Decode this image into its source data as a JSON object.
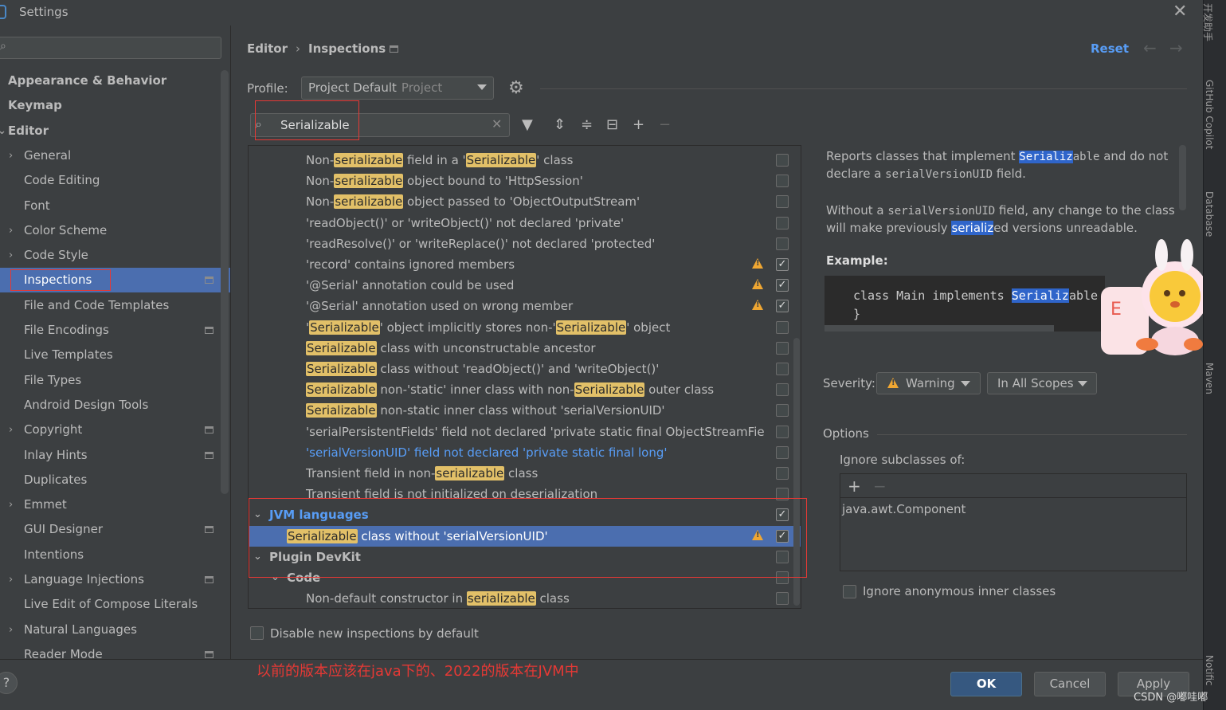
{
  "window": {
    "title": "Settings"
  },
  "sidebar": {
    "items": [
      {
        "label": "Appearance & Behavior",
        "type": "top"
      },
      {
        "label": "Keymap",
        "type": "top"
      },
      {
        "label": "Editor",
        "type": "top-expanded"
      },
      {
        "label": "General",
        "type": "sub-expandable"
      },
      {
        "label": "Code Editing",
        "type": "sub"
      },
      {
        "label": "Font",
        "type": "sub"
      },
      {
        "label": "Color Scheme",
        "type": "sub-expandable"
      },
      {
        "label": "Code Style",
        "type": "sub-expandable"
      },
      {
        "label": "Inspections",
        "type": "sub-selected"
      },
      {
        "label": "File and Code Templates",
        "type": "sub"
      },
      {
        "label": "File Encodings",
        "type": "sub"
      },
      {
        "label": "Live Templates",
        "type": "sub"
      },
      {
        "label": "File Types",
        "type": "sub"
      },
      {
        "label": "Android Design Tools",
        "type": "sub"
      },
      {
        "label": "Copyright",
        "type": "sub-expandable"
      },
      {
        "label": "Inlay Hints",
        "type": "sub"
      },
      {
        "label": "Duplicates",
        "type": "sub"
      },
      {
        "label": "Emmet",
        "type": "sub-expandable"
      },
      {
        "label": "GUI Designer",
        "type": "sub"
      },
      {
        "label": "Intentions",
        "type": "sub"
      },
      {
        "label": "Language Injections",
        "type": "sub-expandable"
      },
      {
        "label": "Live Edit of Compose Literals",
        "type": "sub"
      },
      {
        "label": "Natural Languages",
        "type": "sub-expandable"
      },
      {
        "label": "Reader Mode",
        "type": "sub"
      }
    ]
  },
  "breadcrumb": {
    "parent": "Editor",
    "current": "Inspections"
  },
  "header": {
    "reset": "Reset"
  },
  "profile": {
    "label": "Profile:",
    "value": "Project Default",
    "scope": "Project"
  },
  "search": {
    "value": "Serializable"
  },
  "tree": {
    "rows": [
      {
        "parts": [
          "Non-",
          "serializable",
          " field in a '",
          "Serializable",
          "' class"
        ],
        "checked": false,
        "warn": false
      },
      {
        "parts": [
          "Non-",
          "serializable",
          " object bound to 'HttpSession'"
        ],
        "checked": false,
        "warn": false
      },
      {
        "parts": [
          "Non-",
          "serializable",
          " object passed to 'ObjectOutputStream'"
        ],
        "checked": false,
        "warn": false
      },
      {
        "parts": [
          "'readObject()' or 'writeObject()' not declared 'private'"
        ],
        "checked": false,
        "warn": false
      },
      {
        "parts": [
          "'readResolve()' or 'writeReplace()' not declared 'protected'"
        ],
        "checked": false,
        "warn": false
      },
      {
        "parts": [
          "'record' contains ignored members"
        ],
        "checked": true,
        "warn": true
      },
      {
        "parts": [
          "'@Serial' annotation could be used"
        ],
        "checked": true,
        "warn": true
      },
      {
        "parts": [
          "'@Serial' annotation used on wrong member"
        ],
        "checked": true,
        "warn": true
      },
      {
        "parts": [
          "'",
          "Serializable",
          "' object implicitly stores non-'",
          "Serializable",
          "' object"
        ],
        "checked": false,
        "warn": false
      },
      {
        "parts": [
          "",
          "Serializable",
          " class with unconstructable ancestor"
        ],
        "checked": false,
        "warn": false
      },
      {
        "parts": [
          "",
          "Serializable",
          " class without 'readObject()' and 'writeObject()'"
        ],
        "checked": false,
        "warn": false
      },
      {
        "parts": [
          "",
          "Serializable",
          " non-'static' inner class with non-",
          "Serializable",
          " outer class"
        ],
        "checked": false,
        "warn": false
      },
      {
        "parts": [
          "",
          "Serializable",
          " non-static inner class without 'serialVersionUID'"
        ],
        "checked": false,
        "warn": false
      },
      {
        "parts": [
          "'serialPersistentFields' field not declared 'private static final ObjectStreamFie"
        ],
        "checked": false,
        "warn": false
      },
      {
        "parts": [
          "'serialVersionUID' field not declared 'private static final long'"
        ],
        "checked": false,
        "warn": false,
        "style": "link"
      },
      {
        "parts": [
          "Transient field in non-",
          "serializable",
          " class"
        ],
        "checked": false,
        "warn": false
      },
      {
        "parts": [
          "Transient field is not initialized on deserialization"
        ],
        "checked": false,
        "warn": false
      },
      {
        "parts": [
          "JVM languages"
        ],
        "checked": true,
        "warn": false,
        "style": "group-blue",
        "level": 1
      },
      {
        "parts": [
          "",
          "Serializable",
          " class without 'serialVersionUID'"
        ],
        "checked": true,
        "warn": true,
        "style": "selected",
        "level": 3
      },
      {
        "parts": [
          "Plugin DevKit"
        ],
        "checked": false,
        "warn": false,
        "style": "group",
        "level": 1
      },
      {
        "parts": [
          "Code"
        ],
        "checked": false,
        "warn": false,
        "style": "group",
        "level": 2
      },
      {
        "parts": [
          "Non-default constructor in ",
          "serializable",
          " class"
        ],
        "checked": false,
        "warn": false
      }
    ]
  },
  "disable_new": "Disable new inspections by default",
  "annotation_note": "以前的版本应该在java下的、2022的版本在JVM中",
  "description": {
    "p1_a": "Reports classes that implement ",
    "p1_hl": "Serializ",
    "p1_b": "able",
    "p1_c": " and do not declare a ",
    "p1_code": "serialVersionUID",
    "p1_d": " field.",
    "p2_a": "Without a ",
    "p2_code": "serialVersionUID",
    "p2_b": " field, any change to the class will make previously ",
    "p2_hl": "serializ",
    "p2_c": "ed versions unreadable.",
    "example_label": "Example:",
    "example_line1_a": "class Main implements ",
    "example_line1_hl": "Serializ",
    "example_line1_b": "able",
    "example_line2": "}"
  },
  "severity": {
    "label": "Severity:",
    "value": "Warning",
    "scope": "In All Scopes"
  },
  "options": {
    "label": "Options",
    "ignore_subclasses_label": "Ignore subclasses of:",
    "ignore_subclasses_items": [
      "java.awt.Component"
    ],
    "ignore_anonymous": "Ignore anonymous inner classes"
  },
  "buttons": {
    "help": "?",
    "ok": "OK",
    "cancel": "Cancel",
    "apply": "Apply"
  },
  "right_strip": [
    "开发助手",
    "GitHub Copilot",
    "Database",
    "Maven",
    "Notific"
  ],
  "watermark": "CSDN @嘟哇嘟",
  "colors": {
    "accent": "#589df6",
    "selection": "#4b6eaf",
    "match_highlight": "#e2c068",
    "warning": "#f0a732",
    "annotation": "#e53935"
  }
}
